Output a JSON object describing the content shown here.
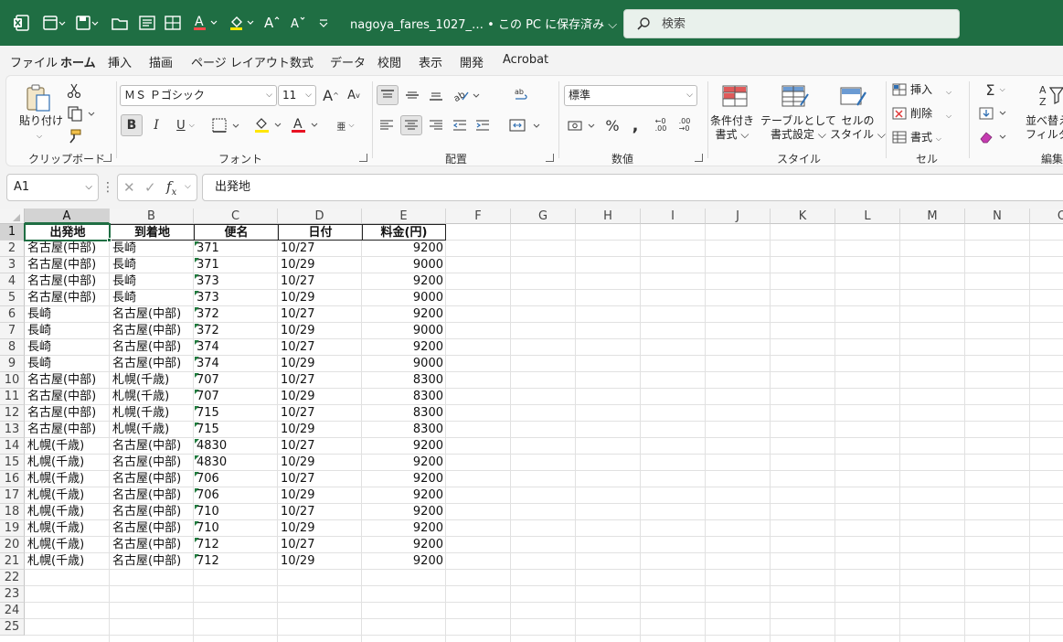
{
  "titlebar": {
    "doc_title": "nagoya_fares_1027_… • この PC に保存済み ⌵",
    "search_placeholder": "検索"
  },
  "menu": {
    "tabs": [
      "ファイル",
      "ホーム",
      "挿入",
      "描画",
      "ページ レイアウト",
      "数式",
      "データ",
      "校閲",
      "表示",
      "開発",
      "Acrobat"
    ],
    "active": "ホーム"
  },
  "ribbon": {
    "clipboard": {
      "paste": "貼り付け",
      "group": "クリップボード"
    },
    "font": {
      "family": "ＭＳ Ｐゴシック",
      "size": "11",
      "group": "フォント"
    },
    "alignment": {
      "group": "配置"
    },
    "number": {
      "format": "標準",
      "group": "数値"
    },
    "styles": {
      "conditional": "条件付き\n書式 ⌵",
      "table": "テーブルとして\n書式設定 ⌵",
      "cell_styles": "セルの\nスタイル ⌵",
      "group": "スタイル"
    },
    "cells": {
      "insert": "挿入",
      "delete": "削除",
      "format": "書式",
      "group": "セル"
    },
    "editing": {
      "sort": "並べ替え",
      "filter": "フィルター",
      "group": "編集"
    }
  },
  "formula_bar": {
    "name_box": "A1",
    "fx": "fx",
    "content": "出発地"
  },
  "sheet": {
    "columns": [
      "A",
      "B",
      "C",
      "D",
      "E",
      "F",
      "G",
      "H",
      "I",
      "J",
      "K",
      "L",
      "M",
      "N",
      "O"
    ],
    "rows": [
      "1",
      "2",
      "3",
      "4",
      "5",
      "6",
      "7",
      "8",
      "9",
      "10",
      "11",
      "12",
      "13",
      "14",
      "15",
      "16",
      "17",
      "18",
      "19",
      "20",
      "21",
      "22",
      "23",
      "24",
      "25"
    ],
    "header": [
      "出発地",
      "到着地",
      "便名",
      "日付",
      "料金(円)"
    ],
    "data": [
      [
        "名古屋(中部)",
        "長崎",
        "371",
        "10/27",
        "9200"
      ],
      [
        "名古屋(中部)",
        "長崎",
        "371",
        "10/29",
        "9000"
      ],
      [
        "名古屋(中部)",
        "長崎",
        "373",
        "10/27",
        "9200"
      ],
      [
        "名古屋(中部)",
        "長崎",
        "373",
        "10/29",
        "9000"
      ],
      [
        "長崎",
        "名古屋(中部)",
        "372",
        "10/27",
        "9200"
      ],
      [
        "長崎",
        "名古屋(中部)",
        "372",
        "10/29",
        "9000"
      ],
      [
        "長崎",
        "名古屋(中部)",
        "374",
        "10/27",
        "9200"
      ],
      [
        "長崎",
        "名古屋(中部)",
        "374",
        "10/29",
        "9000"
      ],
      [
        "名古屋(中部)",
        "札幌(千歳)",
        "707",
        "10/27",
        "8300"
      ],
      [
        "名古屋(中部)",
        "札幌(千歳)",
        "707",
        "10/29",
        "8300"
      ],
      [
        "名古屋(中部)",
        "札幌(千歳)",
        "715",
        "10/27",
        "8300"
      ],
      [
        "名古屋(中部)",
        "札幌(千歳)",
        "715",
        "10/29",
        "8300"
      ],
      [
        "札幌(千歳)",
        "名古屋(中部)",
        "4830",
        "10/27",
        "9200"
      ],
      [
        "札幌(千歳)",
        "名古屋(中部)",
        "4830",
        "10/29",
        "9200"
      ],
      [
        "札幌(千歳)",
        "名古屋(中部)",
        "706",
        "10/27",
        "9200"
      ],
      [
        "札幌(千歳)",
        "名古屋(中部)",
        "706",
        "10/29",
        "9200"
      ],
      [
        "札幌(千歳)",
        "名古屋(中部)",
        "710",
        "10/27",
        "9200"
      ],
      [
        "札幌(千歳)",
        "名古屋(中部)",
        "710",
        "10/29",
        "9200"
      ],
      [
        "札幌(千歳)",
        "名古屋(中部)",
        "712",
        "10/27",
        "9200"
      ],
      [
        "札幌(千歳)",
        "名古屋(中部)",
        "712",
        "10/29",
        "9200"
      ]
    ]
  },
  "colors": {
    "accent": "#1f6e43",
    "text_number_flag": "#1e7a3c"
  }
}
